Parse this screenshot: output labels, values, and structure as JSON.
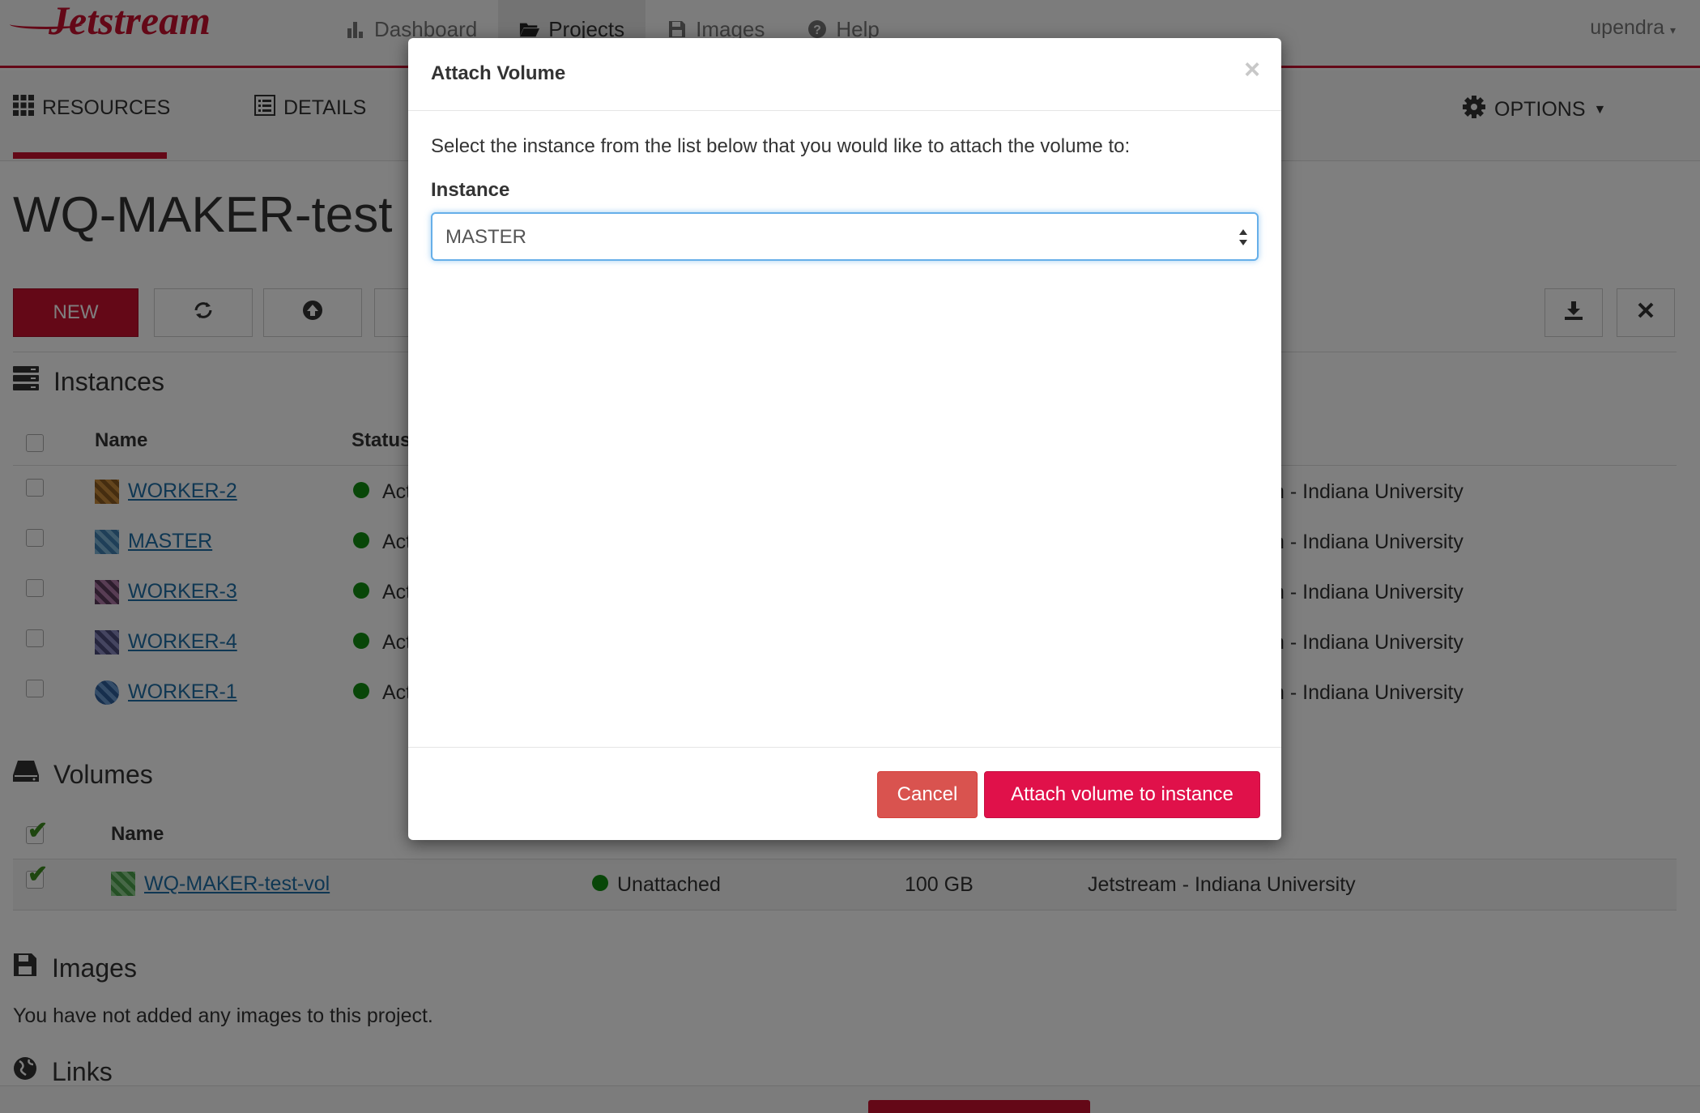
{
  "brand": {
    "logo_text": "Jetstream",
    "accent": "#c8102e"
  },
  "topnav": {
    "items": [
      {
        "label": "Dashboard",
        "icon": "bar-chart-icon"
      },
      {
        "label": "Projects",
        "icon": "folder-open-icon"
      },
      {
        "label": "Images",
        "icon": "floppy-disk-icon"
      },
      {
        "label": "Help",
        "icon": "question-circle-icon"
      }
    ],
    "active": "Projects",
    "user": "upendra"
  },
  "subtabs": {
    "resources": "RESOURCES",
    "details": "DETAILS",
    "options": "OPTIONS"
  },
  "project": {
    "title": "WQ-MAKER-test"
  },
  "toolbar": {
    "new_label": "NEW"
  },
  "instances": {
    "heading": "Instances",
    "col_name": "Name",
    "col_status": "Status",
    "rows": [
      {
        "name": "WORKER-2",
        "status": "Act",
        "provider": "n - Indiana University"
      },
      {
        "name": "MASTER",
        "status": "Act",
        "provider": "n - Indiana University"
      },
      {
        "name": "WORKER-3",
        "status": "Act",
        "provider": "n - Indiana University"
      },
      {
        "name": "WORKER-4",
        "status": "Act",
        "provider": "n - Indiana University"
      },
      {
        "name": "WORKER-1",
        "status": "Act",
        "provider": "n - Indiana University"
      }
    ]
  },
  "volumes": {
    "heading": "Volumes",
    "col_name": "Name",
    "rows": [
      {
        "name": "WQ-MAKER-test-vol",
        "status": "Unattached",
        "size": "100 GB",
        "provider": "Jetstream - Indiana University"
      }
    ]
  },
  "images": {
    "heading": "Images",
    "empty_text": "You have not added any images to this project."
  },
  "links": {
    "heading": "Links"
  },
  "modal": {
    "title": "Attach Volume",
    "close": "×",
    "instruction": "Select the instance from the list below that you would like to attach the volume to:",
    "field_label": "Instance",
    "selected_instance": "MASTER",
    "cancel_label": "Cancel",
    "attach_label": "Attach volume to instance"
  }
}
